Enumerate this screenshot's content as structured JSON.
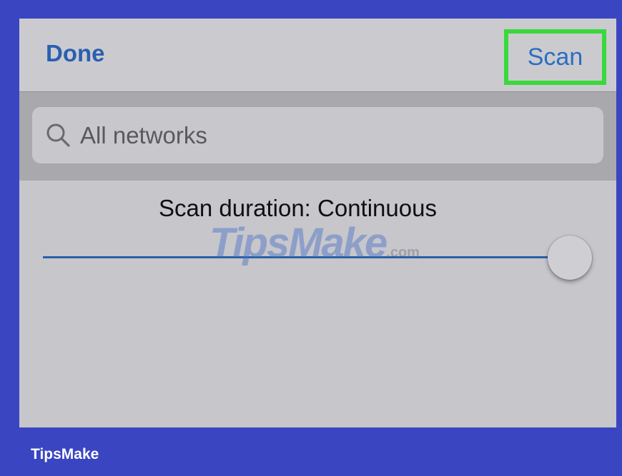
{
  "nav": {
    "done_label": "Done",
    "scan_label": "Scan"
  },
  "search": {
    "placeholder": "All networks"
  },
  "scan_duration": {
    "label": "Scan duration: Continuous",
    "slider_value_fraction": 1.0
  },
  "watermark": {
    "text": "TipsMake",
    "suffix": ".com"
  },
  "footer": {
    "brand": "TipsMake"
  },
  "colors": {
    "frame_background": "#3a45c2",
    "highlight_border": "#39d93b",
    "link_blue": "#2a5fb0",
    "slider_track": "#2c5fa8"
  }
}
